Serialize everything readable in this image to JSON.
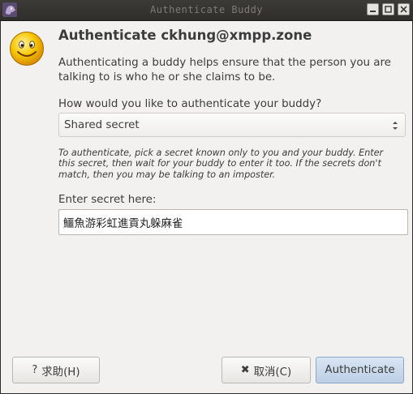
{
  "window": {
    "title": "Authenticate Buddy"
  },
  "dialog": {
    "heading": "Authenticate ckhung@xmpp.zone",
    "description": "Authenticating a buddy helps ensure that the person you are talking to is who he or she claims to be.",
    "question_label": "How would you like to authenticate your buddy?",
    "method_select": {
      "selected": "Shared secret"
    },
    "hint": "To authenticate, pick a secret known only to you and your buddy.  Enter this secret, then wait for your buddy to enter it too.  If the secrets don't match, then you may be talking to an imposter.",
    "secret_label": "Enter secret here:",
    "secret_value": "鱷魚游彩虹進貢丸躲麻雀"
  },
  "buttons": {
    "help_icon": "?",
    "help_label": "求助(H)",
    "cancel_icon": "✖",
    "cancel_label": "取消(C)",
    "authenticate_label": "Authenticate"
  },
  "icons": {
    "app": "pidgin-icon",
    "smiley": "smiley-face-icon",
    "minimize": "minimize-icon",
    "maximize": "maximize-icon",
    "close": "close-icon"
  },
  "colors": {
    "titlebar": "#3c3b37",
    "dialog_bg": "#f2f1f0",
    "default_button": "#bccfe6",
    "smiley": "#f5b800"
  }
}
